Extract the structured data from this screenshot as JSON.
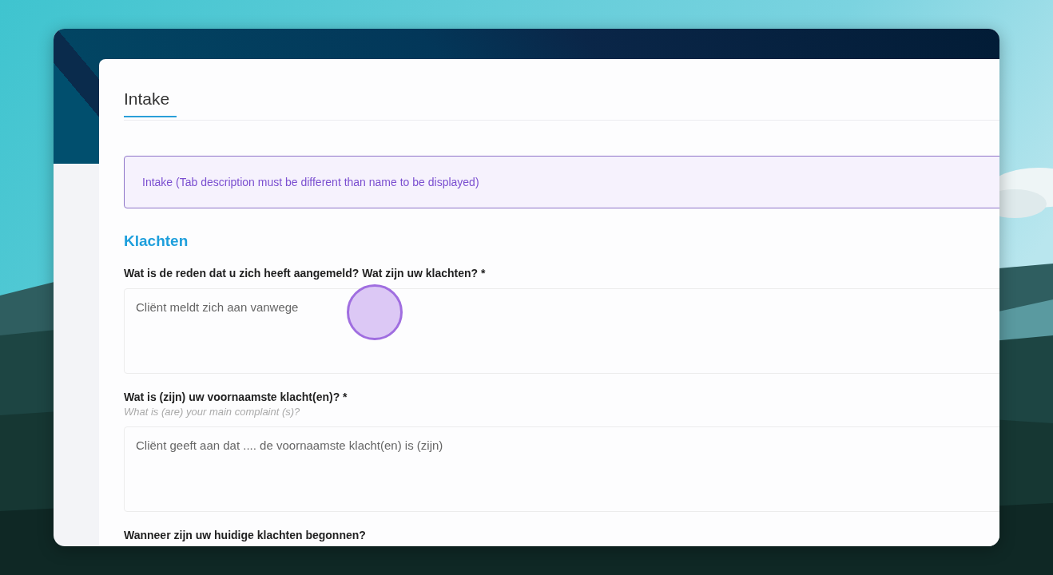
{
  "tabs": [
    {
      "label": "Intake",
      "selected": true
    }
  ],
  "notice": "Intake (Tab description must be different than name to be displayed)",
  "section": {
    "title": "Klachten",
    "questions": [
      {
        "label": "Wat is de reden dat u zich heeft aangemeld? Wat zijn uw klachten? *",
        "answer": "Cliënt meldt zich aan vanwege"
      },
      {
        "label": "Wat is (zijn) uw voornaamste klacht(en)? *",
        "hint": "What is (are) your main complaint (s)?",
        "answer": "Cliënt geeft aan dat .... de voornaamste klacht(en) is (zijn)"
      },
      {
        "label": "Wanneer zijn uw huidige klachten begonnen?"
      }
    ]
  }
}
